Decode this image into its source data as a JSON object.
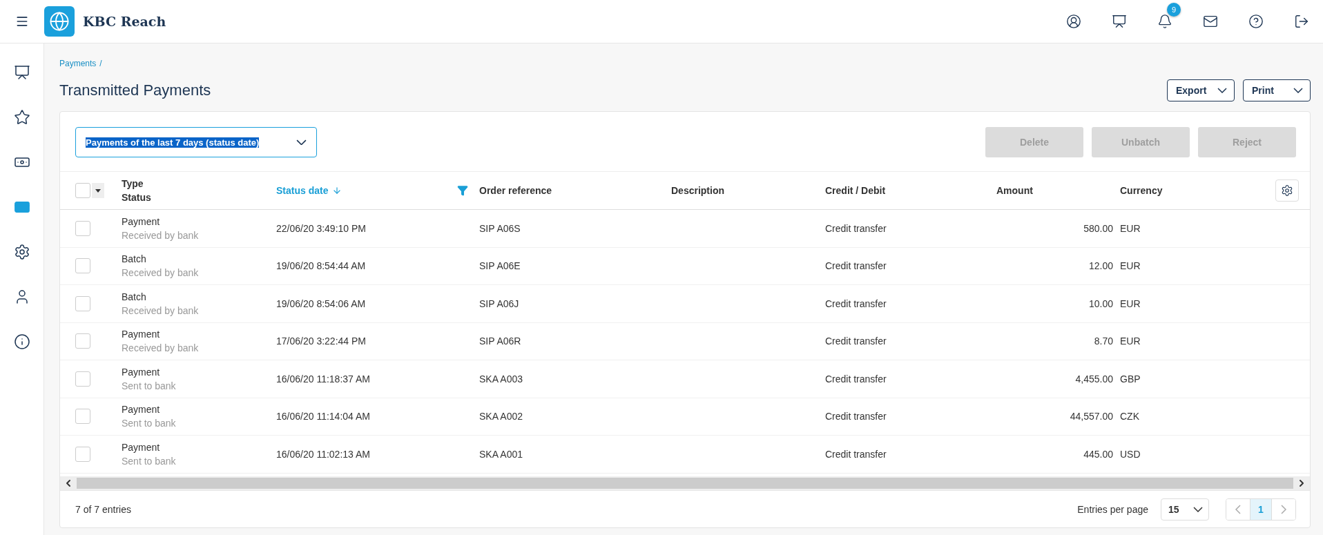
{
  "app": {
    "title": "KBC Reach"
  },
  "top_icons": [
    {
      "kind": "profile"
    },
    {
      "kind": "dashboard"
    },
    {
      "kind": "bell",
      "badge": "9"
    },
    {
      "kind": "mail"
    },
    {
      "kind": "help"
    },
    {
      "kind": "logout"
    }
  ],
  "sidebar": {
    "items": [
      {
        "kind": "dashboard",
        "selected": false
      },
      {
        "kind": "star",
        "selected": false
      },
      {
        "kind": "money",
        "selected": false
      },
      {
        "kind": "card",
        "selected": true
      },
      {
        "kind": "settings",
        "selected": false
      },
      {
        "kind": "user",
        "selected": false
      },
      {
        "kind": "info",
        "selected": false
      }
    ]
  },
  "breadcrumb": [
    {
      "label": "Payments",
      "separator": "/"
    }
  ],
  "page_title": "Transmitted Payments",
  "page_actions": [
    {
      "label": "Export"
    },
    {
      "label": "Print"
    }
  ],
  "filter": {
    "value": "Payments of the last 7 days (status date)",
    "text_selected": true
  },
  "bulk_actions": [
    {
      "label": "Delete",
      "disabled": true
    },
    {
      "label": "Unbatch",
      "disabled": true
    },
    {
      "label": "Reject",
      "disabled": true
    }
  ],
  "table": {
    "select_all_checked": false,
    "columns": [
      {
        "label": "Type",
        "sublabel": "Status"
      },
      {
        "label": "Status date",
        "sorted": true,
        "filtered": true
      },
      {
        "label": "Order reference"
      },
      {
        "label": "Description"
      },
      {
        "label": "Credit / Debit"
      },
      {
        "label": "Amount"
      },
      {
        "label": "Currency"
      }
    ],
    "rows": [
      {
        "checked": false,
        "type": "Payment",
        "status": "Received by bank",
        "status_date": "22/06/20 3:49:10 PM",
        "order_reference": "SIP A06S",
        "credit_debit": "Credit transfer",
        "amount": "580.00",
        "currency": "EUR"
      },
      {
        "checked": false,
        "type": "Batch",
        "status": "Received by bank",
        "status_date": "19/06/20 8:54:44 AM",
        "order_reference": "SIP A06E",
        "credit_debit": "Credit transfer",
        "amount": "12.00",
        "currency": "EUR"
      },
      {
        "checked": false,
        "type": "Batch",
        "status": "Received by bank",
        "status_date": "19/06/20 8:54:06 AM",
        "order_reference": "SIP A06J",
        "credit_debit": "Credit transfer",
        "amount": "10.00",
        "currency": "EUR"
      },
      {
        "checked": false,
        "type": "Payment",
        "status": "Received by bank",
        "status_date": "17/06/20 3:22:44 PM",
        "order_reference": "SIP A06R",
        "credit_debit": "Credit transfer",
        "amount": "8.70",
        "currency": "EUR"
      },
      {
        "checked": false,
        "type": "Payment",
        "status": "Sent to bank",
        "status_date": "16/06/20 11:18:37 AM",
        "order_reference": "SKA A003",
        "credit_debit": "Credit transfer",
        "amount": "4,455.00",
        "currency": "GBP"
      },
      {
        "checked": false,
        "type": "Payment",
        "status": "Sent to bank",
        "status_date": "16/06/20 11:14:04 AM",
        "order_reference": "SKA A002",
        "credit_debit": "Credit transfer",
        "amount": "44,557.00",
        "currency": "CZK"
      },
      {
        "checked": false,
        "type": "Payment",
        "status": "Sent to bank",
        "status_date": "16/06/20 11:02:13 AM",
        "order_reference": "SKA A001",
        "credit_debit": "Credit transfer",
        "amount": "445.00",
        "currency": "USD"
      }
    ]
  },
  "footer": {
    "entries": "7 of 7 entries",
    "per_page_label": "Entries per page",
    "per_page": "15",
    "pages": [
      {
        "label": "1",
        "selected": true
      }
    ]
  }
}
